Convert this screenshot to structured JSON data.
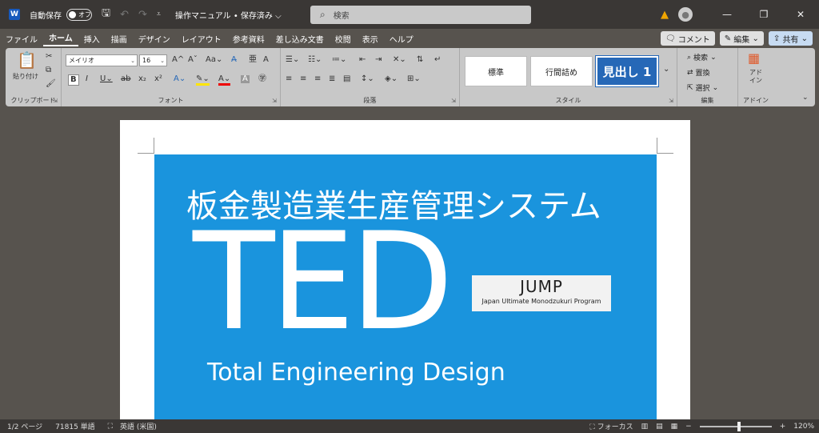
{
  "titlebar": {
    "word_logo": "W",
    "autosave_label": "自動保存",
    "autosave_state": "オフ",
    "doc_title": "操作マニュアル • 保存済み ⌵",
    "search_placeholder": "検索",
    "icons": [
      "save-icon",
      "undo-icon",
      "redo-icon",
      "customize-icon",
      "warning-icon",
      "avatar-icon"
    ],
    "window_controls": [
      "—",
      "❐",
      "✕"
    ]
  },
  "menu": {
    "items": [
      "ファイル",
      "ホーム",
      "挿入",
      "描画",
      "デザイン",
      "レイアウト",
      "参考資料",
      "差し込み文書",
      "校閲",
      "表示",
      "ヘルプ"
    ],
    "active": "ホーム",
    "comment_label": "コメント",
    "edit_label": "編集",
    "share_label": "共有"
  },
  "ribbon": {
    "clipboard": {
      "paste_label": "貼り付け",
      "group_label": "クリップボード"
    },
    "font": {
      "font_name": "メイリオ",
      "font_size": "16",
      "group_label": "フォント"
    },
    "paragraph": {
      "group_label": "段落"
    },
    "styles": {
      "items": [
        "標準",
        "行間詰め",
        "見出し 1"
      ],
      "group_label": "スタイル"
    },
    "editing": {
      "find_label": "検索",
      "replace_label": "置換",
      "select_label": "選択",
      "group_label": "編集"
    },
    "addin": {
      "label_1": "アド",
      "label_2": "イン",
      "group_label": "アドイン"
    }
  },
  "document": {
    "title_jp": "板金製造業生産管理システム",
    "ted": "TED",
    "ted_sub": "Total Engineering Design",
    "jump_title": "JUMP",
    "jump_sub": "Japan Ultimate Monodzukuri Program",
    "cover_color": "#1a94dd"
  },
  "status": {
    "page": "1/2 ページ",
    "words": "71815 単語",
    "language": "英語 (米国)",
    "focus": "フォーカス",
    "zoom": "120%",
    "zoom_level": 0.55
  }
}
